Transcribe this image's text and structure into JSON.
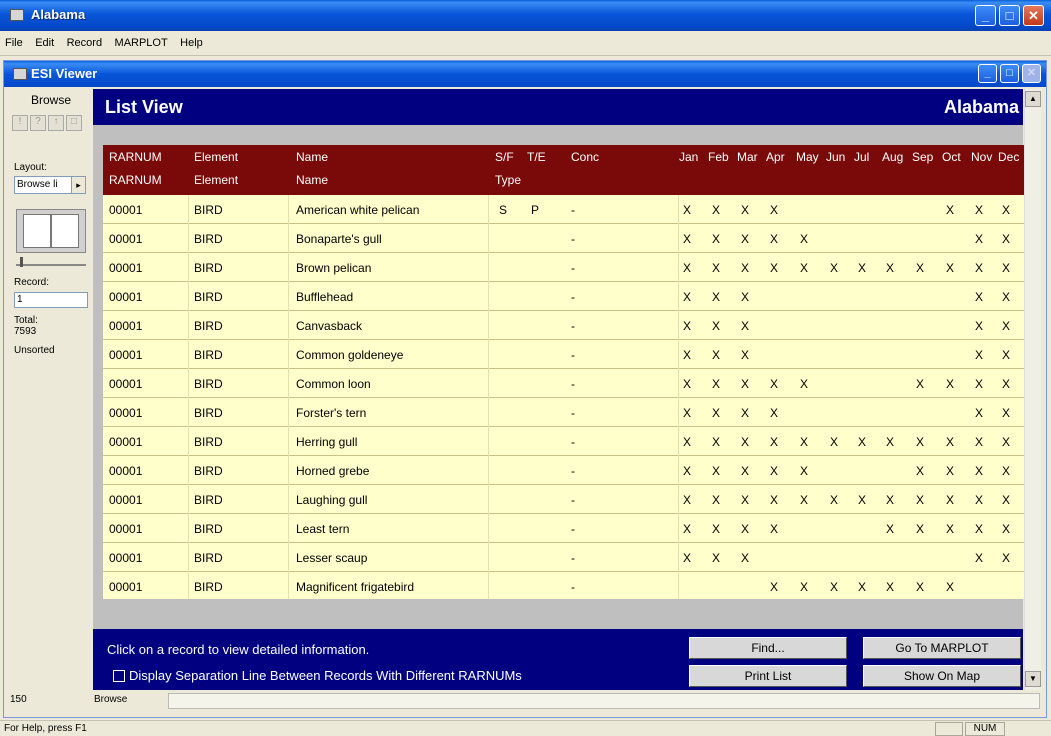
{
  "app": {
    "title": "Alabama",
    "menu": [
      "File",
      "Edit",
      "Record",
      "MARPLOT",
      "Help"
    ],
    "status_help": "For Help, press F1",
    "status_num": "NUM"
  },
  "viewer": {
    "title": "ESI Viewer",
    "left": {
      "mode_label": "Browse",
      "layout_label": "Layout:",
      "layout_value": "Browse li",
      "record_label": "Record:",
      "record_value": "1",
      "total_label": "Total:",
      "total_value": "7593",
      "sort_label": "Unsorted"
    },
    "header": {
      "view_title": "List View",
      "state": "Alabama"
    },
    "columns_row1": [
      "RARNUM",
      "Element",
      "Name",
      "S/F",
      "T/E",
      "Conc"
    ],
    "columns_row2": [
      "RARNUM",
      "Element",
      "Name",
      "Type"
    ],
    "months": [
      "Jan",
      "Feb",
      "Mar",
      "Apr",
      "May",
      "Jun",
      "Jul",
      "Aug",
      "Sep",
      "Oct",
      "Nov",
      "Dec"
    ],
    "rows": [
      {
        "rarnum": "00001",
        "element": "BIRD",
        "name": "American white pelican",
        "sf": "S",
        "te": "P",
        "conc": "-",
        "m": [
          "X",
          "X",
          "X",
          "X",
          "",
          "",
          "",
          "",
          "",
          "X",
          "X",
          "X"
        ]
      },
      {
        "rarnum": "00001",
        "element": "BIRD",
        "name": "Bonaparte's gull",
        "sf": "",
        "te": "",
        "conc": "-",
        "m": [
          "X",
          "X",
          "X",
          "X",
          "X",
          "",
          "",
          "",
          "",
          "",
          "X",
          "X"
        ]
      },
      {
        "rarnum": "00001",
        "element": "BIRD",
        "name": "Brown pelican",
        "sf": "",
        "te": "",
        "conc": "-",
        "m": [
          "X",
          "X",
          "X",
          "X",
          "X",
          "X",
          "X",
          "X",
          "X",
          "X",
          "X",
          "X"
        ]
      },
      {
        "rarnum": "00001",
        "element": "BIRD",
        "name": "Bufflehead",
        "sf": "",
        "te": "",
        "conc": "-",
        "m": [
          "X",
          "X",
          "X",
          "",
          "",
          "",
          "",
          "",
          "",
          "",
          "X",
          "X"
        ]
      },
      {
        "rarnum": "00001",
        "element": "BIRD",
        "name": "Canvasback",
        "sf": "",
        "te": "",
        "conc": "-",
        "m": [
          "X",
          "X",
          "X",
          "",
          "",
          "",
          "",
          "",
          "",
          "",
          "X",
          "X"
        ]
      },
      {
        "rarnum": "00001",
        "element": "BIRD",
        "name": "Common goldeneye",
        "sf": "",
        "te": "",
        "conc": "-",
        "m": [
          "X",
          "X",
          "X",
          "",
          "",
          "",
          "",
          "",
          "",
          "",
          "X",
          "X"
        ]
      },
      {
        "rarnum": "00001",
        "element": "BIRD",
        "name": "Common loon",
        "sf": "",
        "te": "",
        "conc": "-",
        "m": [
          "X",
          "X",
          "X",
          "X",
          "X",
          "",
          "",
          "",
          "X",
          "X",
          "X",
          "X"
        ]
      },
      {
        "rarnum": "00001",
        "element": "BIRD",
        "name": "Forster's tern",
        "sf": "",
        "te": "",
        "conc": "-",
        "m": [
          "X",
          "X",
          "X",
          "X",
          "",
          "",
          "",
          "",
          "",
          "",
          "X",
          "X"
        ]
      },
      {
        "rarnum": "00001",
        "element": "BIRD",
        "name": "Herring gull",
        "sf": "",
        "te": "",
        "conc": "-",
        "m": [
          "X",
          "X",
          "X",
          "X",
          "X",
          "X",
          "X",
          "X",
          "X",
          "X",
          "X",
          "X"
        ]
      },
      {
        "rarnum": "00001",
        "element": "BIRD",
        "name": "Horned grebe",
        "sf": "",
        "te": "",
        "conc": "-",
        "m": [
          "X",
          "X",
          "X",
          "X",
          "X",
          "",
          "",
          "",
          "X",
          "X",
          "X",
          "X"
        ]
      },
      {
        "rarnum": "00001",
        "element": "BIRD",
        "name": "Laughing gull",
        "sf": "",
        "te": "",
        "conc": "-",
        "m": [
          "X",
          "X",
          "X",
          "X",
          "X",
          "X",
          "X",
          "X",
          "X",
          "X",
          "X",
          "X"
        ]
      },
      {
        "rarnum": "00001",
        "element": "BIRD",
        "name": "Least tern",
        "sf": "",
        "te": "",
        "conc": "-",
        "m": [
          "X",
          "X",
          "X",
          "X",
          "",
          "",
          "",
          "X",
          "X",
          "X",
          "X",
          "X"
        ]
      },
      {
        "rarnum": "00001",
        "element": "BIRD",
        "name": "Lesser scaup",
        "sf": "",
        "te": "",
        "conc": "-",
        "m": [
          "X",
          "X",
          "X",
          "",
          "",
          "",
          "",
          "",
          "",
          "",
          "X",
          "X"
        ]
      },
      {
        "rarnum": "00001",
        "element": "BIRD",
        "name": "Magnificent frigatebird",
        "sf": "",
        "te": "",
        "conc": "-",
        "m": [
          "",
          "",
          "",
          "X",
          "X",
          "X",
          "X",
          "X",
          "X",
          "X",
          "",
          ""
        ]
      }
    ],
    "footer": {
      "hint": "Click on a record to view detailed information.",
      "checkbox_label": "Display Separation Line Between Records With Different RARNUMs",
      "find": "Find...",
      "go_marplot": "Go To MARPLOT",
      "print_list": "Print List",
      "show_on_map": "Show On Map"
    },
    "zoom": "150",
    "mode_status": "Browse"
  }
}
